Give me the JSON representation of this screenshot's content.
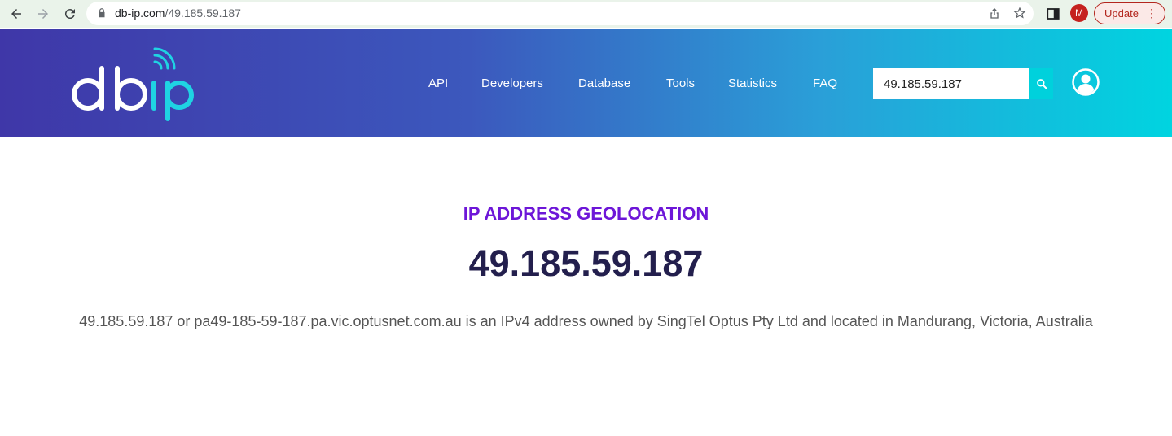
{
  "browser": {
    "url_domain": "db-ip.com",
    "url_path": "/49.185.59.187",
    "profile_initial": "M",
    "update_label": "Update",
    "icons": [
      "back-arrow-icon",
      "forward-arrow-icon",
      "reload-icon",
      "lock-icon",
      "share-icon",
      "star-icon",
      "sidebar-icon",
      "more-vert-icon"
    ]
  },
  "header": {
    "logo_text": "dbip",
    "nav": [
      "API",
      "Developers",
      "Database",
      "Tools",
      "Statistics",
      "FAQ"
    ],
    "search_value": "49.185.59.187",
    "colors": {
      "gradient_start": "#3f37a8",
      "gradient_end": "#00d4e0",
      "accent": "#00d1dc"
    }
  },
  "main": {
    "headline": "IP ADDRESS GEOLOCATION",
    "ip": "49.185.59.187",
    "description": "49.185.59.187 or pa49-185-59-187.pa.vic.optusnet.com.au is an IPv4 address owned by SingTel Optus Pty Ltd and located in Mandurang, Victoria, Australia",
    "colors": {
      "headline": "#6d16d8",
      "ip": "#231f4d"
    }
  }
}
